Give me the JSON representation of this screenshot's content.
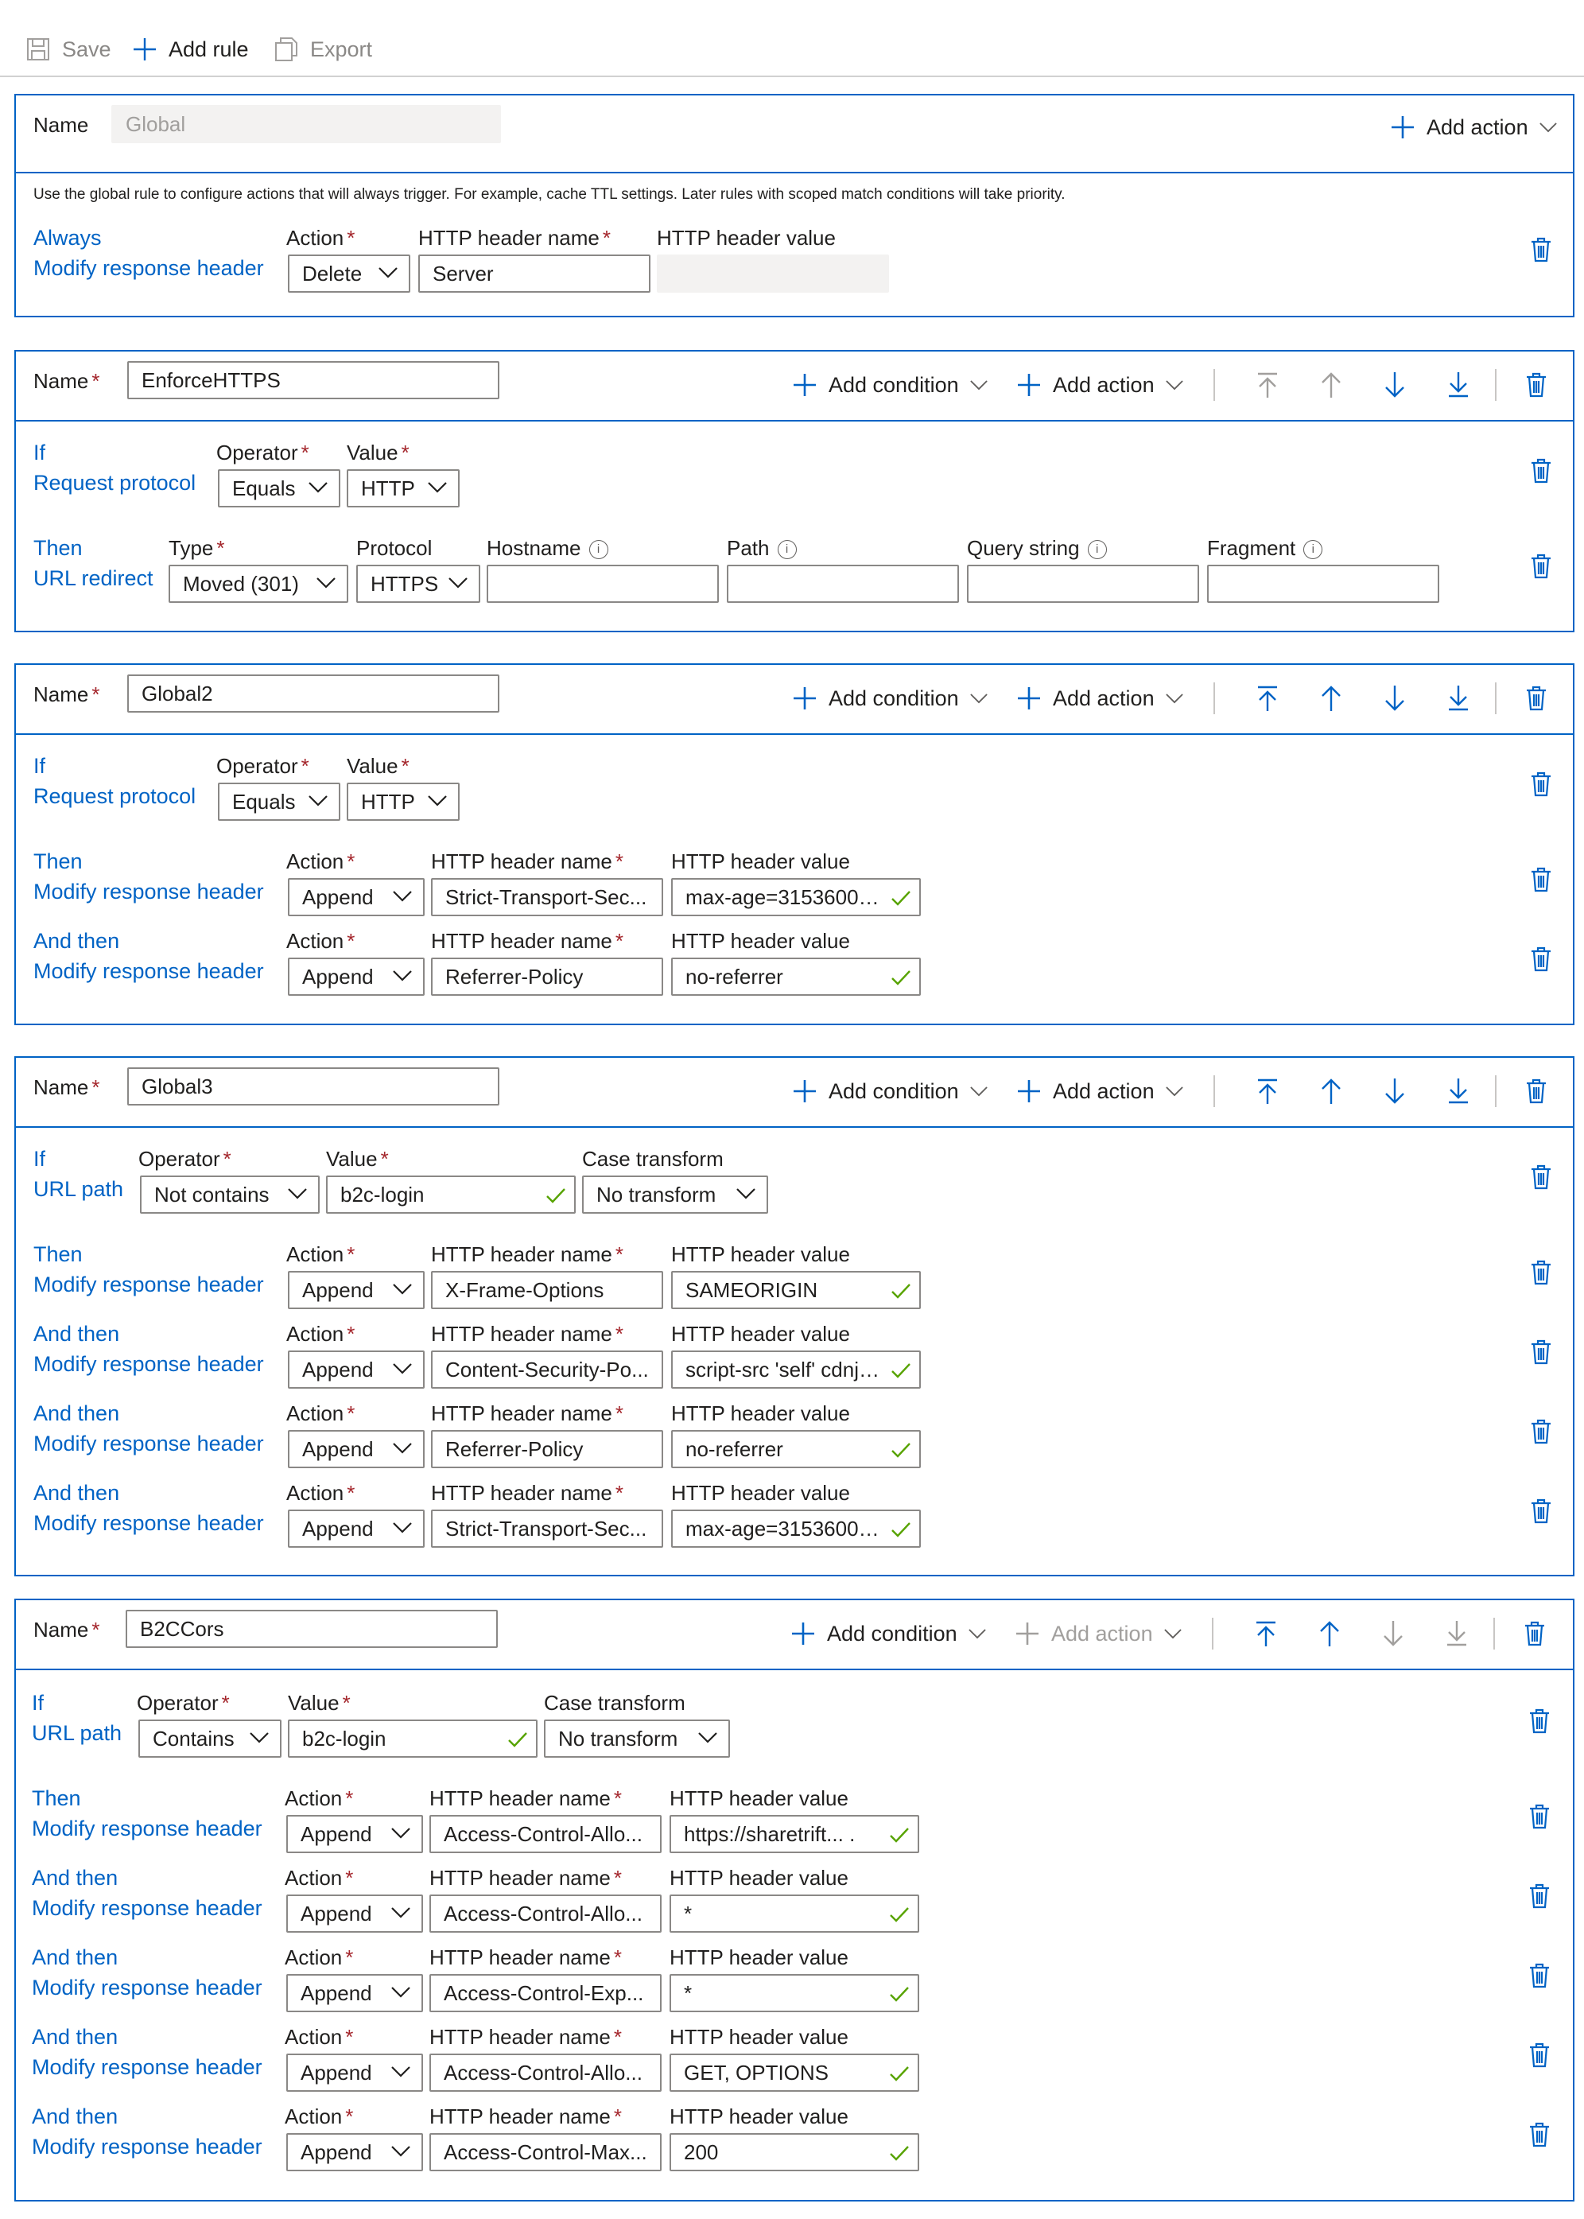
{
  "toolbar": {
    "save": "Save",
    "add_rule": "Add rule",
    "export": "Export"
  },
  "common": {
    "name_label": "Name",
    "add_action": "Add action",
    "add_condition": "Add condition",
    "action_label": "Action",
    "header_name_label": "HTTP header name",
    "header_value_label": "HTTP header value",
    "operator_label": "Operator",
    "value_label": "Value",
    "case_transform_label": "Case transform",
    "required_mark": "*",
    "info_glyph": "i",
    "colors": {
      "accent": "#0063c5",
      "required": "#a4262c",
      "check": "#57a300",
      "border": "#8a8886"
    }
  },
  "global_rule": {
    "name_value": "Global",
    "description": "Use the global rule to configure actions that will always trigger. For example, cache TTL settings. Later rules with scoped match conditions will take priority.",
    "trigger": "Always",
    "action_type": "Modify response header",
    "action": "Delete",
    "header_name": "Server",
    "header_value": ""
  },
  "rule_enforcehttps": {
    "name_value": "EnforceHTTPS",
    "cond_prefix": "If",
    "cond_type": "Request protocol",
    "operator": "Equals",
    "value": "HTTP",
    "action_prefix": "Then",
    "action_type": "URL redirect",
    "type_label": "Type",
    "type_value": "Moved (301)",
    "protocol_label": "Protocol",
    "protocol_value": "HTTPS",
    "hostname_label": "Hostname",
    "path_label": "Path",
    "query_label": "Query string",
    "fragment_label": "Fragment",
    "hostname": "",
    "path": "",
    "query": "",
    "fragment": ""
  },
  "rule_global2": {
    "name_value": "Global2",
    "cond_prefix": "If",
    "cond_type": "Request protocol",
    "operator": "Equals",
    "value": "HTTP",
    "actions": [
      {
        "prefix": "Then",
        "type": "Modify response header",
        "action": "Append",
        "header_name": "Strict-Transport-Sec...",
        "header_value": "max-age=31536000;..."
      },
      {
        "prefix": "And then",
        "type": "Modify response header",
        "action": "Append",
        "header_name": "Referrer-Policy",
        "header_value": "no-referrer"
      }
    ]
  },
  "rule_global3": {
    "name_value": "Global3",
    "cond_prefix": "If",
    "cond_type": "URL path",
    "operator": "Not contains",
    "value": "b2c-login",
    "case_transform": "No transform",
    "actions": [
      {
        "prefix": "Then",
        "type": "Modify response header",
        "action": "Append",
        "header_name": "X-Frame-Options",
        "header_value": "SAMEORIGIN"
      },
      {
        "prefix": "And then",
        "type": "Modify response header",
        "action": "Append",
        "header_name": "Content-Security-Po...",
        "header_value": "script-src 'self' cdnjs...."
      },
      {
        "prefix": "And then",
        "type": "Modify response header",
        "action": "Append",
        "header_name": "Referrer-Policy",
        "header_value": "no-referrer"
      },
      {
        "prefix": "And then",
        "type": "Modify response header",
        "action": "Append",
        "header_name": "Strict-Transport-Sec...",
        "header_value": "max-age=31536000;..."
      }
    ]
  },
  "rule_b2ccors": {
    "name_value": "B2CCors",
    "cond_prefix": "If",
    "cond_type": "URL path",
    "operator": "Contains",
    "value": "b2c-login",
    "case_transform": "No transform",
    "actions": [
      {
        "prefix": "Then",
        "type": "Modify response header",
        "action": "Append",
        "header_name": "Access-Control-Allo...",
        "header_value": "https://sharetrift...  ."
      },
      {
        "prefix": "And then",
        "type": "Modify response header",
        "action": "Append",
        "header_name": "Access-Control-Allo...",
        "header_value": "*"
      },
      {
        "prefix": "And then",
        "type": "Modify response header",
        "action": "Append",
        "header_name": "Access-Control-Exp...",
        "header_value": "*"
      },
      {
        "prefix": "And then",
        "type": "Modify response header",
        "action": "Append",
        "header_name": "Access-Control-Allo...",
        "header_value": "GET, OPTIONS"
      },
      {
        "prefix": "And then",
        "type": "Modify response header",
        "action": "Append",
        "header_name": "Access-Control-Max...",
        "header_value": "200"
      }
    ]
  }
}
